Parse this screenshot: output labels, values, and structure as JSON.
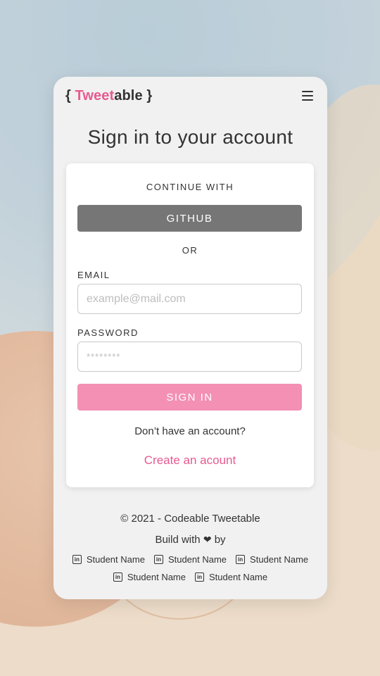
{
  "logo": {
    "open": "{ ",
    "accent": "Tweet",
    "rest": "able",
    "close": " }"
  },
  "colors": {
    "accent": "#e75a8f",
    "github_button": "#767676",
    "signin_button": "#f390b4",
    "card_bg": "#f1f1f1"
  },
  "menu_icon": "hamburger-menu-icon",
  "title": "Sign in to your account",
  "form": {
    "continue_with": "CONTINUE WITH",
    "github_label": "GITHUB",
    "or_label": "OR",
    "email_label": "EMAIL",
    "email_placeholder": "example@mail.com",
    "password_label": "PASSWORD",
    "password_placeholder": "********",
    "signin_label": "SIGN IN",
    "no_account": "Don’t have an account?",
    "create_link": "Create an acount"
  },
  "footer": {
    "copyright": "© 2021 - Codeable Tweetable",
    "build_with": "Build with",
    "by": "by",
    "heart_icon": "heart-icon",
    "student_icon": "linkedin-icon",
    "students": [
      "Student Name",
      "Student Name",
      "Student Name",
      "Student Name",
      "Student Name"
    ]
  }
}
